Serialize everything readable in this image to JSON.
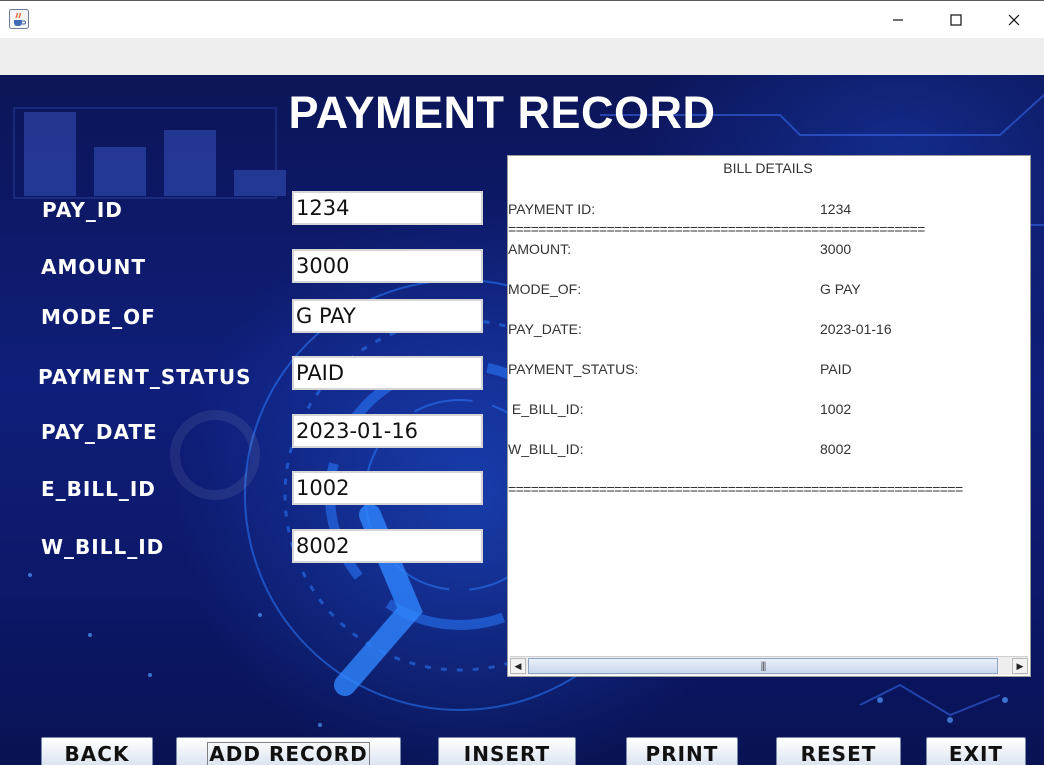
{
  "window": {
    "icon": "java-coffee-cup-icon",
    "controls": [
      "minimize-icon",
      "maximize-icon",
      "close-icon"
    ]
  },
  "page": {
    "title": "PAYMENT RECORD"
  },
  "form": {
    "fields": [
      {
        "label": "PAY_ID",
        "value": "1234"
      },
      {
        "label": "AMOUNT",
        "value": "3000"
      },
      {
        "label": "MODE_OF",
        "value": "G PAY"
      },
      {
        "label": "PAYMENT_STATUS",
        "value": "PAID"
      },
      {
        "label": "PAY_DATE",
        "value": "2023-01-16"
      },
      {
        "label": "E_BILL_ID",
        "value": "1002"
      },
      {
        "label": "W_BILL_ID",
        "value": "8002"
      }
    ]
  },
  "bill": {
    "heading": "BILL DETAILS",
    "rows": [
      {
        "label": "PAYMENT ID:",
        "value": "1234"
      },
      {
        "label": "AMOUNT:",
        "value": "3000"
      },
      {
        "label": "MODE_OF:",
        "value": "G PAY"
      },
      {
        "label": "PAY_DATE:",
        "value": "2023-01-16"
      },
      {
        "label": "PAYMENT_STATUS:",
        "value": "PAID"
      },
      {
        "label": " E_BILL_ID:",
        "value": "1002"
      },
      {
        "label": "W_BILL_ID:",
        "value": "8002"
      }
    ],
    "separator_short": "=======================================================",
    "separator_long": "============================================================"
  },
  "buttons": {
    "back": "BACK",
    "add_record": "ADD RECORD",
    "insert": "INSERT",
    "print": "PRINT",
    "reset": "RESET",
    "exit": "EXIT"
  },
  "colors": {
    "background": "#0f1e7a",
    "accent": "#2a7bff",
    "title_text": "#ffffff"
  }
}
